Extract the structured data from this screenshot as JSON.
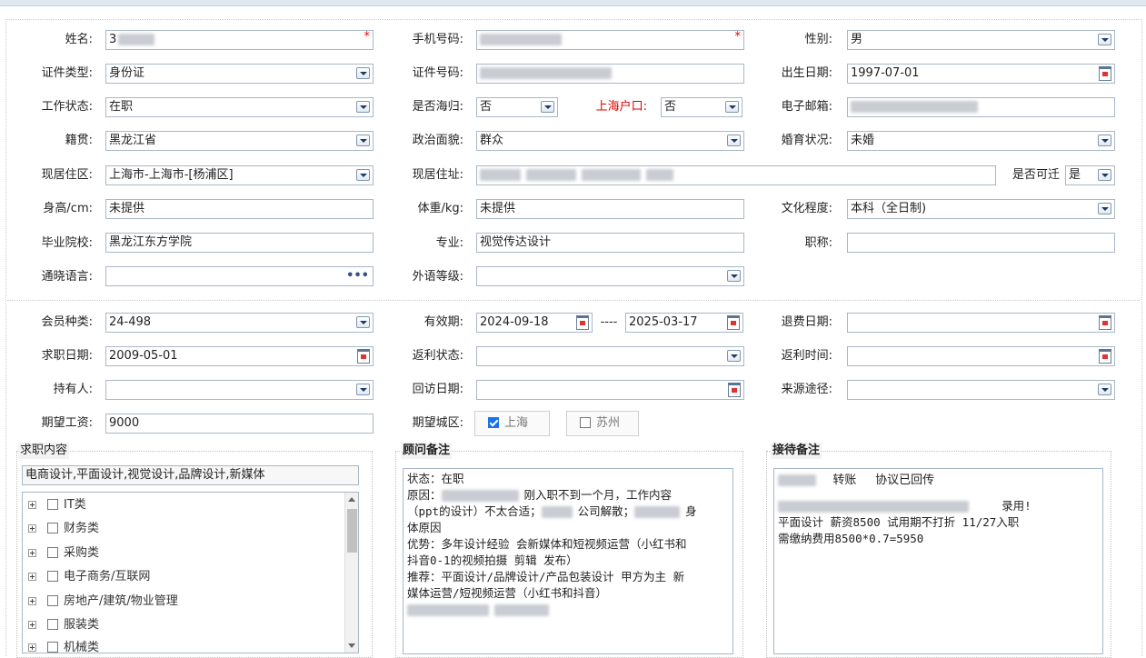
{
  "form": {
    "name": {
      "label": "姓名:",
      "value": "3"
    },
    "phone": {
      "label": "手机号码:"
    },
    "gender": {
      "label": "性别:",
      "value": "男"
    },
    "id_type": {
      "label": "证件类型:",
      "value": "身份证"
    },
    "id_number": {
      "label": "证件号码:"
    },
    "birth_date": {
      "label": "出生日期:",
      "value": "1997-07-01"
    },
    "work_status": {
      "label": "工作状态:",
      "value": "在职"
    },
    "overseas_return": {
      "label": "是否海归:",
      "value": "否"
    },
    "shanghai_hukou": {
      "label": "上海户口:",
      "value": "否"
    },
    "email": {
      "label": "电子邮箱:"
    },
    "native_place": {
      "label": "籍贯:",
      "value": "黑龙江省"
    },
    "political_status": {
      "label": "政治面貌:",
      "value": "群众"
    },
    "marital_status": {
      "label": "婚育状况:",
      "value": "未婚"
    },
    "residence_area": {
      "label": "现居住区:",
      "value": "上海市-上海市-[杨浦区]"
    },
    "residence_address": {
      "label": "现居住址:"
    },
    "relocatable": {
      "label": "是否可迁",
      "value": "是"
    },
    "height": {
      "label": "身高/cm:",
      "value": "未提供"
    },
    "weight": {
      "label": "体重/kg:",
      "value": "未提供"
    },
    "education": {
      "label": "文化程度:",
      "value": "本科（全日制)"
    },
    "school": {
      "label": "毕业院校:",
      "value": "黑龙江东方学院"
    },
    "major": {
      "label": "专业:",
      "value": "视觉传达设计"
    },
    "title": {
      "label": "职称:",
      "value": ""
    },
    "languages": {
      "label": "通晓语言:",
      "value": ""
    },
    "foreign_level": {
      "label": "外语等级:",
      "value": ""
    },
    "member_type": {
      "label": "会员种类:",
      "value": "24-498"
    },
    "valid_period": {
      "label": "有效期:",
      "start": "2024-09-18",
      "sep": "----",
      "end": "2025-03-17"
    },
    "refund_date": {
      "label": "退费日期:",
      "value": ""
    },
    "job_seek_date": {
      "label": "求职日期:",
      "value": "2009-05-01"
    },
    "rebate_status": {
      "label": "返利状态:",
      "value": ""
    },
    "rebate_time": {
      "label": "返利时间:",
      "value": ""
    },
    "holder": {
      "label": "持有人:",
      "value": ""
    },
    "visit_date": {
      "label": "回访日期:",
      "value": ""
    },
    "source": {
      "label": "来源途径:",
      "value": ""
    },
    "expected_salary": {
      "label": "期望工资:",
      "value": "9000"
    },
    "expected_city": {
      "label": "期望城区:",
      "options": [
        {
          "label": "上海",
          "checked": true
        },
        {
          "label": "苏州",
          "checked": false
        }
      ]
    }
  },
  "job_content": {
    "title": "求职内容",
    "summary": "电商设计,平面设计,视觉设计,品牌设计,新媒体",
    "tree": [
      "IT类",
      "财务类",
      "采购类",
      "电子商务/互联网",
      "房地产/建筑/物业管理",
      "服装类",
      "机械类"
    ]
  },
  "advisor_notes": {
    "title": "顾问备注",
    "lines": [
      "状态：在职",
      "原因：",
      "刚入职不到一个月，工作内容",
      "（ppt的设计）不太合适；",
      "公司解散；",
      "身",
      "体原因",
      "优势：多年设计经验 会新媒体和短视频运营（小红书和",
      "抖音0-1的视频拍摄 剪辑 发布）",
      "推荐：平面设计/品牌设计/产品包装设计  甲方为主 新",
      "媒体运营/短视频运营（小红书和抖音）"
    ]
  },
  "reception_notes": {
    "title": "接待备注",
    "lines": [
      "转账",
      "协议已回传",
      "录用!",
      "平面设计 薪资8500 试用期不打折 11/27入职",
      "需缴纳费用8500*0.7=5950"
    ]
  }
}
